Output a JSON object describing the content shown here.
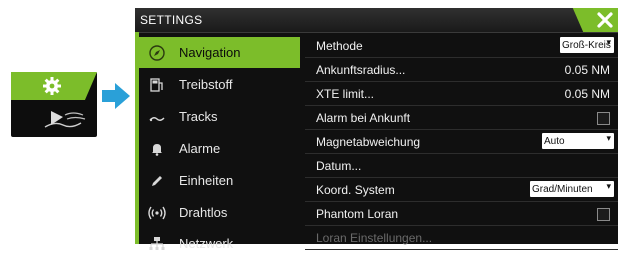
{
  "window": {
    "title": "SETTINGS"
  },
  "menu": {
    "items": [
      {
        "label": "Navigation",
        "icon": "navigation-icon",
        "active": true
      },
      {
        "label": "Treibstoff",
        "icon": "fuel-icon"
      },
      {
        "label": "Tracks",
        "icon": "tracks-icon"
      },
      {
        "label": "Alarme",
        "icon": "bell-icon"
      },
      {
        "label": "Einheiten",
        "icon": "pencil-icon"
      },
      {
        "label": "Drahtlos",
        "icon": "wireless-icon"
      },
      {
        "label": "Netzwerk",
        "icon": "network-icon"
      }
    ]
  },
  "settings": {
    "rows": [
      {
        "label": "Methode",
        "control": "select",
        "value": "Groß-Kreis"
      },
      {
        "label": "Ankunftsradius...",
        "control": "value",
        "value": "0.05 NM"
      },
      {
        "label": "XTE limit...",
        "control": "value",
        "value": "0.05 NM"
      },
      {
        "label": "Alarm bei Ankunft",
        "control": "checkbox",
        "checked": false
      },
      {
        "label": "Magnetabweichung",
        "control": "select",
        "value": "Auto"
      },
      {
        "label": "Datum...",
        "control": "none"
      },
      {
        "label": "Koord. System",
        "control": "select",
        "value": "Grad/Minuten"
      },
      {
        "label": "Phantom Loran",
        "control": "checkbox",
        "checked": false
      },
      {
        "label": "Loran Einstellungen...",
        "control": "none",
        "disabled": true
      }
    ]
  },
  "colors": {
    "accent": "#7cbd2a",
    "background": "#101010",
    "text": "#f2f2f2"
  }
}
